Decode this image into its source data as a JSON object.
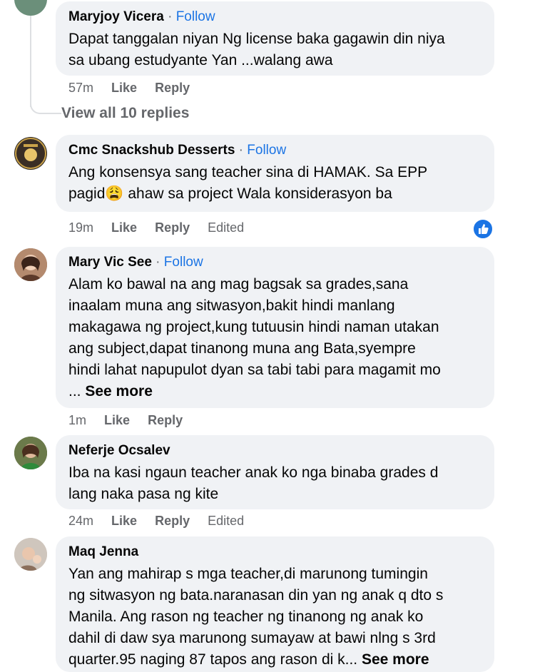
{
  "view_all_replies": "View all 10 replies",
  "comments": [
    {
      "name": "Maryjoy Vicera",
      "follow": "Follow",
      "lines": [
        "Dapat tanggalan niyan Ng license baka gagawin din niya",
        "sa ubang estudyante Yan ...walang awa"
      ],
      "time": "57m",
      "like": "Like",
      "reply": "Reply",
      "edited": ""
    },
    {
      "name": "Cmc Snackshub Desserts",
      "follow": "Follow",
      "lines": [
        "Ang konsensya sang teacher sina di HAMAK. Sa EPP",
        "pagid😩 ahaw sa project Wala konsiderasyon ba"
      ],
      "time": "19m",
      "like": "Like",
      "reply": "Reply",
      "edited": "Edited"
    },
    {
      "name": "Mary Vic See",
      "follow": "Follow",
      "lines": [
        "Alam ko bawal na ang mag bagsak sa grades,sana",
        "inaalam muna ang sitwasyon,bakit hindi manlang",
        "makagawa ng project,kung tutuusin hindi naman utakan",
        "ang subject,dapat tinanong muna ang Bata,syempre",
        "hindi lahat napupulot dyan sa tabi tabi para magamit mo"
      ],
      "ellipsis": "... ",
      "see_more": "See more",
      "time": "1m",
      "like": "Like",
      "reply": "Reply",
      "edited": ""
    },
    {
      "name": "Neferje Ocsalev",
      "follow": "",
      "lines": [
        "Iba na kasi ngaun teacher anak ko nga binaba grades d",
        "lang naka pasa ng kite"
      ],
      "time": "24m",
      "like": "Like",
      "reply": "Reply",
      "edited": "Edited"
    },
    {
      "name": "Maq Jenna",
      "follow": "",
      "lines": [
        "Yan ang mahirap s mga teacher,di marunong tumingin",
        "ng sitwasyon ng bata.naranasan din yan ng anak q dto s",
        "Manila. Ang rason ng teacher ng tinanong ng anak ko",
        "dahil di daw sya marunong sumayaw at bawi nlng s 3rd",
        "quarter.95 naging 87 tapos ang rason di k... "
      ],
      "see_more": "See more"
    }
  ],
  "colors": {
    "bubble": "#f0f2f5",
    "link": "#1b74e4",
    "meta": "#65676b"
  }
}
